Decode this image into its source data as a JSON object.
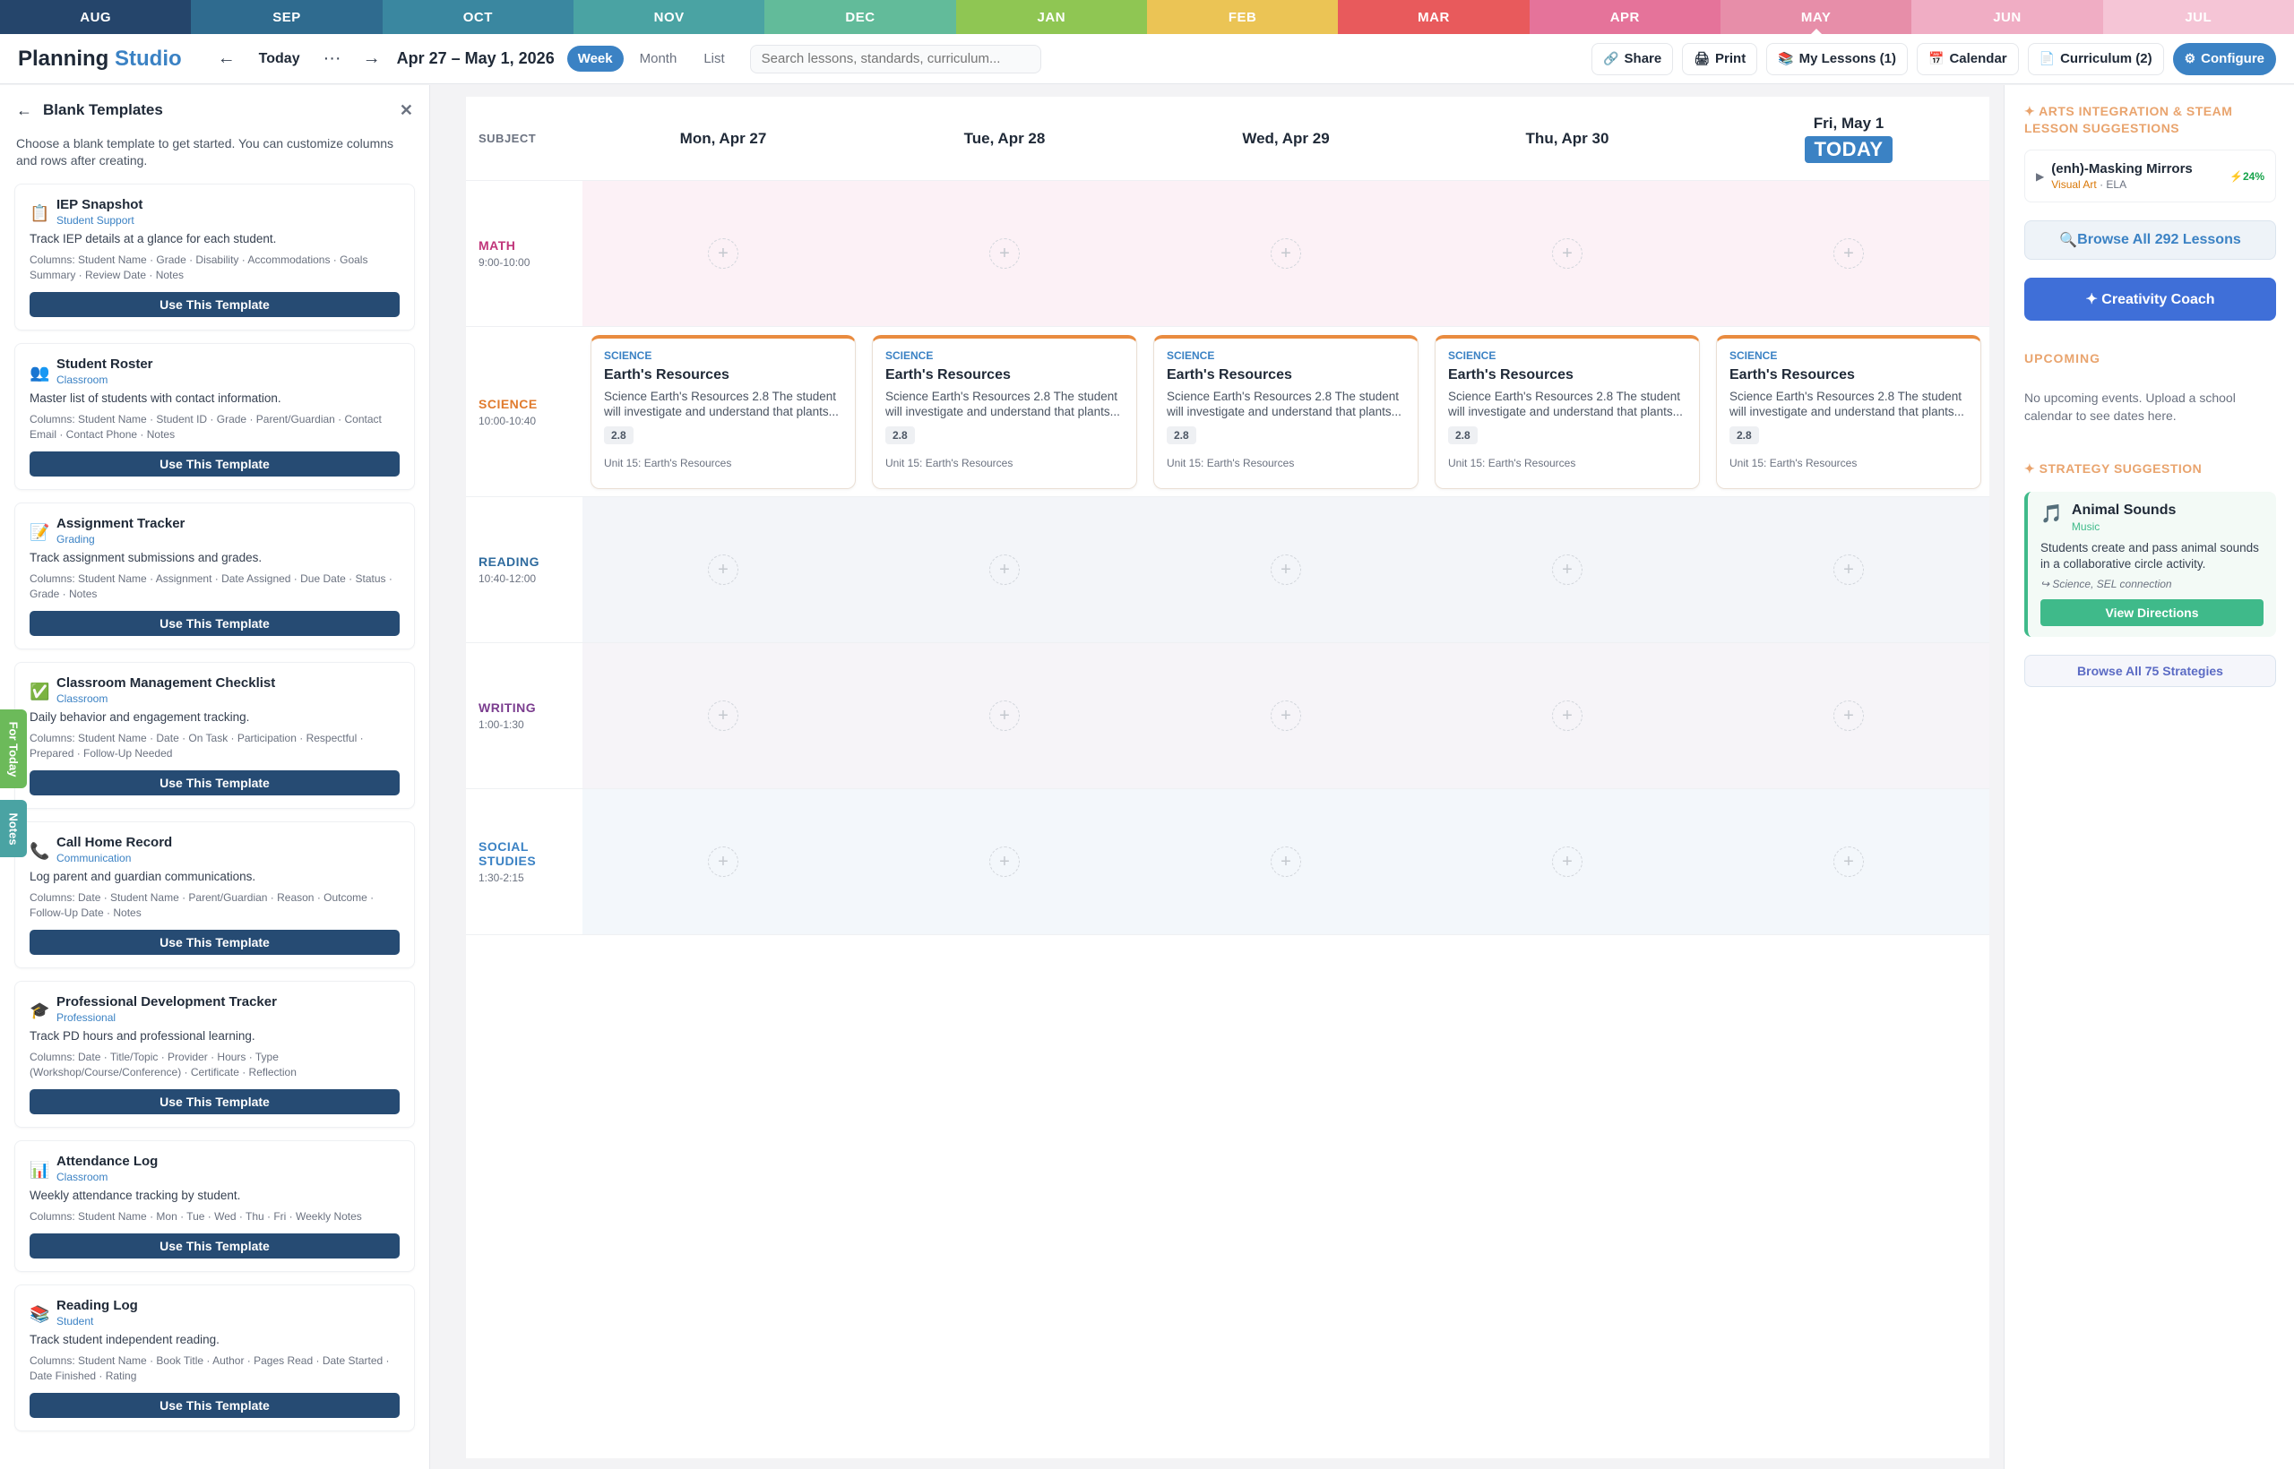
{
  "months": [
    {
      "label": "AUG",
      "color": "#25456b"
    },
    {
      "label": "SEP",
      "color": "#2f6b8f"
    },
    {
      "label": "OCT",
      "color": "#3a87a0"
    },
    {
      "label": "NOV",
      "color": "#4aa3a3"
    },
    {
      "label": "DEC",
      "color": "#62bb9a"
    },
    {
      "label": "JAN",
      "color": "#8fc653"
    },
    {
      "label": "FEB",
      "color": "#ebc455"
    },
    {
      "label": "MAR",
      "color": "#e85a5c"
    },
    {
      "label": "APR",
      "color": "#e5739a"
    },
    {
      "label": "MAY",
      "color": "#e78ea9"
    },
    {
      "label": "JUN",
      "color": "#f0adc4"
    },
    {
      "label": "JUL",
      "color": "#f5c5d6"
    }
  ],
  "header": {
    "brand_main": "Planning",
    "brand_accent": "Studio",
    "prev": "←",
    "today": "Today",
    "more": "···",
    "next": "→",
    "date_range": "Apr 27 – May 1, 2026",
    "views": [
      "Week",
      "Month",
      "List"
    ],
    "search_placeholder": "Search lessons, standards, curriculum...",
    "share": "Share",
    "print": "Print",
    "my_lessons": "My Lessons (1)",
    "calendar": "Calendar",
    "curriculum": "Curriculum (2)",
    "configure": "Configure"
  },
  "left_panel": {
    "title": "Blank Templates",
    "intro": "Choose a blank template to get started. You can customize columns and rows after creating.",
    "button_label": "Use This Template",
    "templates": [
      {
        "icon": "📋",
        "name": "IEP Snapshot",
        "category": "Student Support",
        "desc": "Track IEP details at a glance for each student.",
        "cols": "Columns: Student Name · Grade · Disability · Accommodations · Goals Summary · Review Date · Notes"
      },
      {
        "icon": "👥",
        "name": "Student Roster",
        "category": "Classroom",
        "desc": "Master list of students with contact information.",
        "cols": "Columns: Student Name · Student ID · Grade · Parent/Guardian · Contact Email · Contact Phone · Notes"
      },
      {
        "icon": "📝",
        "name": "Assignment Tracker",
        "category": "Grading",
        "desc": "Track assignment submissions and grades.",
        "cols": "Columns: Student Name · Assignment · Date Assigned · Due Date · Status · Grade · Notes"
      },
      {
        "icon": "✅",
        "name": "Classroom Management Checklist",
        "category": "Classroom",
        "desc": "Daily behavior and engagement tracking.",
        "cols": "Columns: Student Name · Date · On Task · Participation · Respectful · Prepared · Follow-Up Needed"
      },
      {
        "icon": "📞",
        "name": "Call Home Record",
        "category": "Communication",
        "desc": "Log parent and guardian communications.",
        "cols": "Columns: Date · Student Name · Parent/Guardian · Reason · Outcome · Follow-Up Date · Notes"
      },
      {
        "icon": "🎓",
        "name": "Professional Development Tracker",
        "category": "Professional",
        "desc": "Track PD hours and professional learning.",
        "cols": "Columns: Date · Title/Topic · Provider · Hours · Type (Workshop/Course/Conference) · Certificate · Reflection"
      },
      {
        "icon": "📊",
        "name": "Attendance Log",
        "category": "Classroom",
        "desc": "Weekly attendance tracking by student.",
        "cols": "Columns: Student Name · Mon · Tue · Wed · Thu · Fri · Weekly Notes"
      },
      {
        "icon": "📚",
        "name": "Reading Log",
        "category": "Student",
        "desc": "Track student independent reading.",
        "cols": "Columns: Student Name · Book Title · Author · Pages Read · Date Started · Date Finished · Rating"
      }
    ]
  },
  "side_tabs": {
    "for_today": "For Today",
    "notes": "Notes"
  },
  "calendar": {
    "subject_header": "SUBJECT",
    "days": [
      "Mon, Apr 27",
      "Tue, Apr 28",
      "Wed, Apr 29",
      "Thu, Apr 30",
      "Fri, May 1"
    ],
    "today_badge": "TODAY",
    "rows": [
      {
        "name": "MATH",
        "time": "9:00-10:00",
        "color": "#c0357a",
        "bg": "#fcf1f6"
      },
      {
        "name": "SCIENCE",
        "time": "10:00-10:40",
        "color": "#e07b2e",
        "bg": "#ffffff"
      },
      {
        "name": "READING",
        "time": "10:40-12:00",
        "color": "#2f6b9e",
        "bg": "#f3f5f9"
      },
      {
        "name": "WRITING",
        "time": "1:00-1:30",
        "color": "#7b3d8f",
        "bg": "#f6f4f8"
      },
      {
        "name": "SOCIAL STUDIES",
        "time": "1:30-2:15",
        "color": "#3b82c4",
        "bg": "#f3f7fb"
      }
    ],
    "lesson": {
      "subject": "SCIENCE",
      "title": "Earth's Resources",
      "desc": "Science Earth's Resources 2.8 The student will investigate and understand that plants...",
      "standard": "2.8",
      "unit": "Unit 15: Earth's Resources"
    }
  },
  "right_panel": {
    "suggestions_title": "✦ ARTS INTEGRATION & STEAM LESSON SUGGESTIONS",
    "suggestion": {
      "name": "(enh)-Masking Mirrors",
      "art": "Visual Art",
      "ela": "· ELA",
      "pct": "⚡24%"
    },
    "browse_lessons": "Browse All 292 Lessons",
    "creativity_coach": "✦ Creativity Coach",
    "upcoming_title": "UPCOMING",
    "upcoming_text": "No upcoming events. Upload a school calendar to see dates here.",
    "strategy_title": "✦ STRATEGY SUGGESTION",
    "strategy": {
      "icon": "🎵",
      "name": "Animal Sounds",
      "category": "Music",
      "desc": "Students create and pass animal sounds in a collaborative circle activity.",
      "connection": "↪ Science, SEL connection",
      "button": "View Directions"
    },
    "browse_strategies": "Browse All 75 Strategies"
  }
}
